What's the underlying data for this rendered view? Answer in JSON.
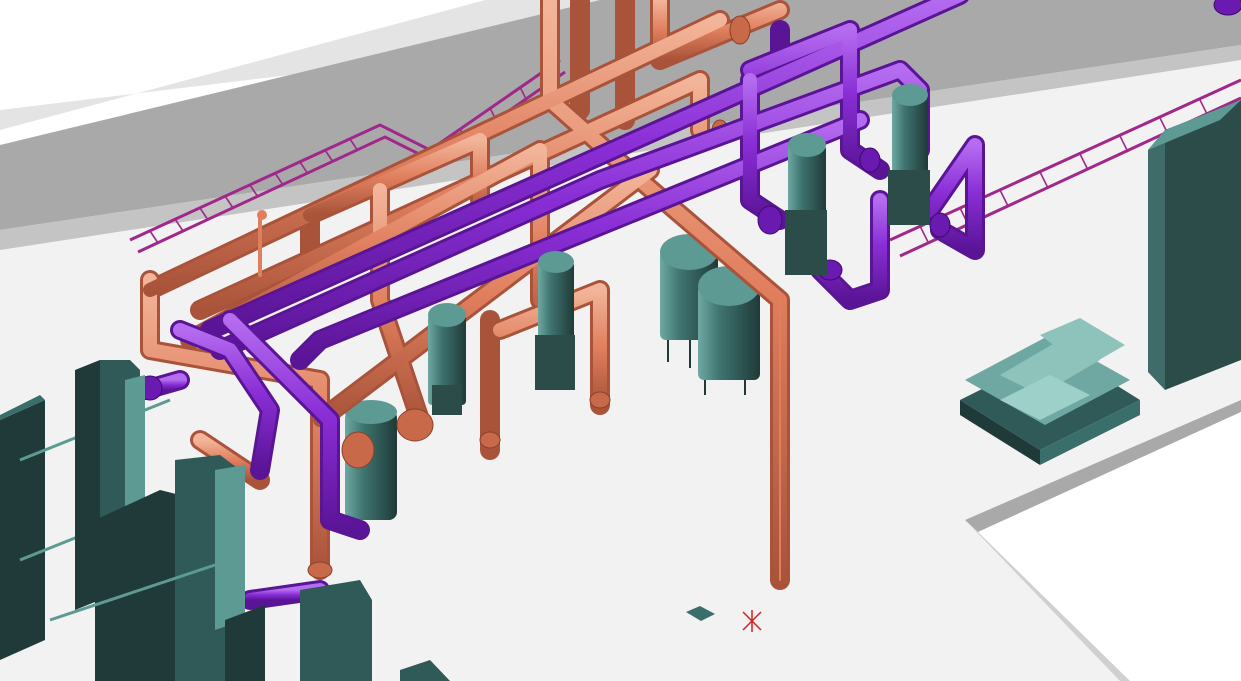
{
  "scene": {
    "kind": "3D plant piping model viewport",
    "colors": {
      "background": "#ffffff",
      "floor": "#f2f2f2",
      "wall": "#a8a8a8",
      "wall_top": "#d6d6d6",
      "pipe_copper": "#e07f5e",
      "pipe_copper_dark": "#b55d40",
      "pipe_purple": "#8a2ed6",
      "pipe_purple_dark": "#6418a8",
      "cable_tray": "#a0288a",
      "equipment": "#3a6e6a",
      "equipment_dark": "#1f3a38",
      "equipment_light": "#5d9a94",
      "marker": "#d62020"
    },
    "objects": [
      {
        "name": "plate-heat-exchanger",
        "count": 4
      },
      {
        "name": "vertical-pump",
        "count": 4
      },
      {
        "name": "storage-tank",
        "count": 2
      },
      {
        "name": "filter-vessel",
        "count": 1
      },
      {
        "name": "electrical-cabinet",
        "count": 1
      },
      {
        "name": "pallet-stack",
        "count": 1
      },
      {
        "name": "cable-tray",
        "count": 2
      }
    ]
  }
}
